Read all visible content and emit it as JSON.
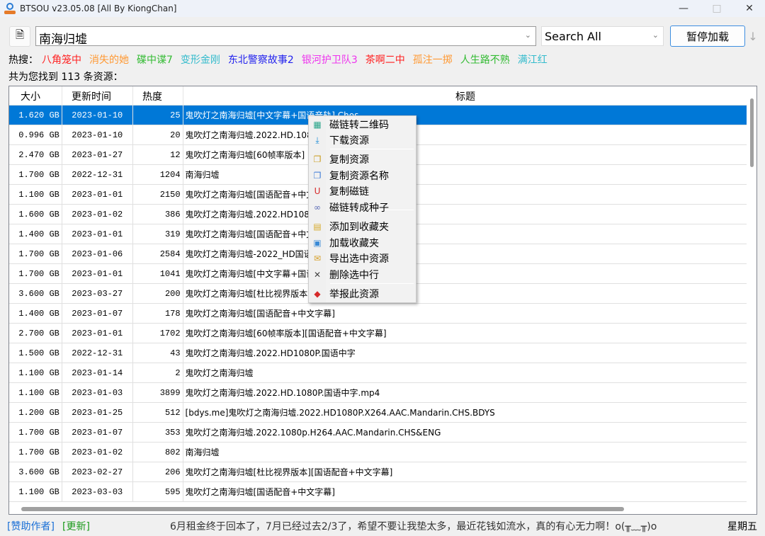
{
  "window": {
    "title": "BTSOU v23.05.08 [All By KiongChan]"
  },
  "toolbar": {
    "search_value": "南海归墟",
    "engine": "Search All",
    "pause_label": "暂停加载",
    "down_arrow": "↓"
  },
  "hot": {
    "label": "热搜：",
    "items": [
      {
        "text": "八角笼中",
        "color": "#ff2020"
      },
      {
        "text": "消失的她",
        "color": "#ff9933"
      },
      {
        "text": "碟中谍7",
        "color": "#33bb33"
      },
      {
        "text": "变形金刚",
        "color": "#33bbcc"
      },
      {
        "text": "东北警察故事2",
        "color": "#2222ee"
      },
      {
        "text": "银河护卫队3",
        "color": "#ee33ee"
      },
      {
        "text": "茶啊二中",
        "color": "#ff2020"
      },
      {
        "text": "孤注一掷",
        "color": "#ff9933"
      },
      {
        "text": "人生路不熟",
        "color": "#33bb33"
      },
      {
        "text": "满江红",
        "color": "#33bbcc"
      }
    ]
  },
  "result_count": "共为您找到 113 条资源：",
  "table": {
    "headers": [
      "大小",
      "更新时间",
      "热度",
      "标题"
    ],
    "rows": [
      [
        "1.620 GB",
        "2023-01-10",
        "25",
        "鬼吹灯之南海归墟[中文字幕+国语音轨].Chos"
      ],
      [
        "0.996 GB",
        "2023-01-10",
        "20",
        "鬼吹灯之南海归墟.2022.HD.108"
      ],
      [
        "2.470 GB",
        "2023-01-27",
        "12",
        "鬼吹灯之南海归墟[60帧率版本]"
      ],
      [
        "1.700 GB",
        "2022-12-31",
        "1204",
        "南海归墟"
      ],
      [
        "1.100 GB",
        "2023-01-01",
        "2150",
        "鬼吹灯之南海归墟[国语配音+中文"
      ],
      [
        "1.600 GB",
        "2023-01-02",
        "386",
        "鬼吹灯之南海归墟.2022.HD1080"
      ],
      [
        "1.400 GB",
        "2023-01-01",
        "319",
        "鬼吹灯之南海归墟[国语配音+中文"
      ],
      [
        "1.700 GB",
        "2023-01-06",
        "2584",
        "鬼吹灯之南海归墟-2022_HD国语"
      ],
      [
        "1.700 GB",
        "2023-01-01",
        "1041",
        "鬼吹灯之南海归墟[中文字幕+国语"
      ],
      [
        "3.600 GB",
        "2023-03-27",
        "200",
        "鬼吹灯之南海归墟[杜比视界版本"
      ],
      [
        "1.400 GB",
        "2023-01-07",
        "178",
        "鬼吹灯之南海归墟[国语配音+中文字幕]"
      ],
      [
        "2.700 GB",
        "2023-01-01",
        "1702",
        "鬼吹灯之南海归墟[60帧率版本][国语配音+中文字幕]"
      ],
      [
        "1.500 GB",
        "2022-12-31",
        "43",
        "鬼吹灯之南海归墟.2022.HD1080P.国语中字"
      ],
      [
        "1.100 GB",
        "2023-01-14",
        "2",
        "鬼吹灯之南海归墟"
      ],
      [
        "1.100 GB",
        "2023-01-03",
        "3899",
        "鬼吹灯之南海归墟.2022.HD.1080P.国语中字.mp4"
      ],
      [
        "1.200 GB",
        "2023-01-25",
        "512",
        "[bdys.me]鬼吹灯之南海归墟.2022.HD1080P.X264.AAC.Mandarin.CHS.BDYS"
      ],
      [
        "1.700 GB",
        "2023-01-07",
        "353",
        "鬼吹灯之南海归墟.2022.1080p.H264.AAC.Mandarin.CHS&ENG"
      ],
      [
        "1.700 GB",
        "2023-01-02",
        "802",
        "南海归墟"
      ],
      [
        "3.600 GB",
        "2023-02-27",
        "206",
        "鬼吹灯之南海归墟[杜比视界版本][国语配音+中文字幕]"
      ],
      [
        "1.100 GB",
        "2023-03-03",
        "595",
        "鬼吹灯之南海归墟[国语配音+中文字幕]"
      ]
    ]
  },
  "context_menu": {
    "items": [
      {
        "label": "磁链转二维码",
        "icon": "qr-code-icon"
      },
      {
        "label": "下载资源",
        "icon": "download-icon"
      },
      {
        "label": "复制资源",
        "icon": "copy-icon"
      },
      {
        "label": "复制资源名称",
        "icon": "copy-name-icon"
      },
      {
        "label": "复制磁链",
        "icon": "magnet-icon"
      },
      {
        "label": "磁链转成种子",
        "icon": "link-icon"
      },
      {
        "label": "添加到收藏夹",
        "icon": "add-favorite-icon"
      },
      {
        "label": "加载收藏夹",
        "icon": "load-favorite-icon"
      },
      {
        "label": "导出选中资源",
        "icon": "export-icon"
      },
      {
        "label": "删除选中行",
        "icon": "delete-icon"
      },
      {
        "label": "举报此资源",
        "icon": "report-icon"
      }
    ]
  },
  "status": {
    "sponsor": "[赞助作者]",
    "update": "[更新]",
    "message": "6月租金终于回本了，7月已经过去2/3了，希望不要让我垫太多，最近花钱如流水，真的有心无力啊！o(╥﹏╥)o",
    "weekday": "星期五"
  },
  "colors": {
    "selection": "#0078d7",
    "sponsor": "#1a6fd6",
    "update": "#1a9a1a"
  }
}
